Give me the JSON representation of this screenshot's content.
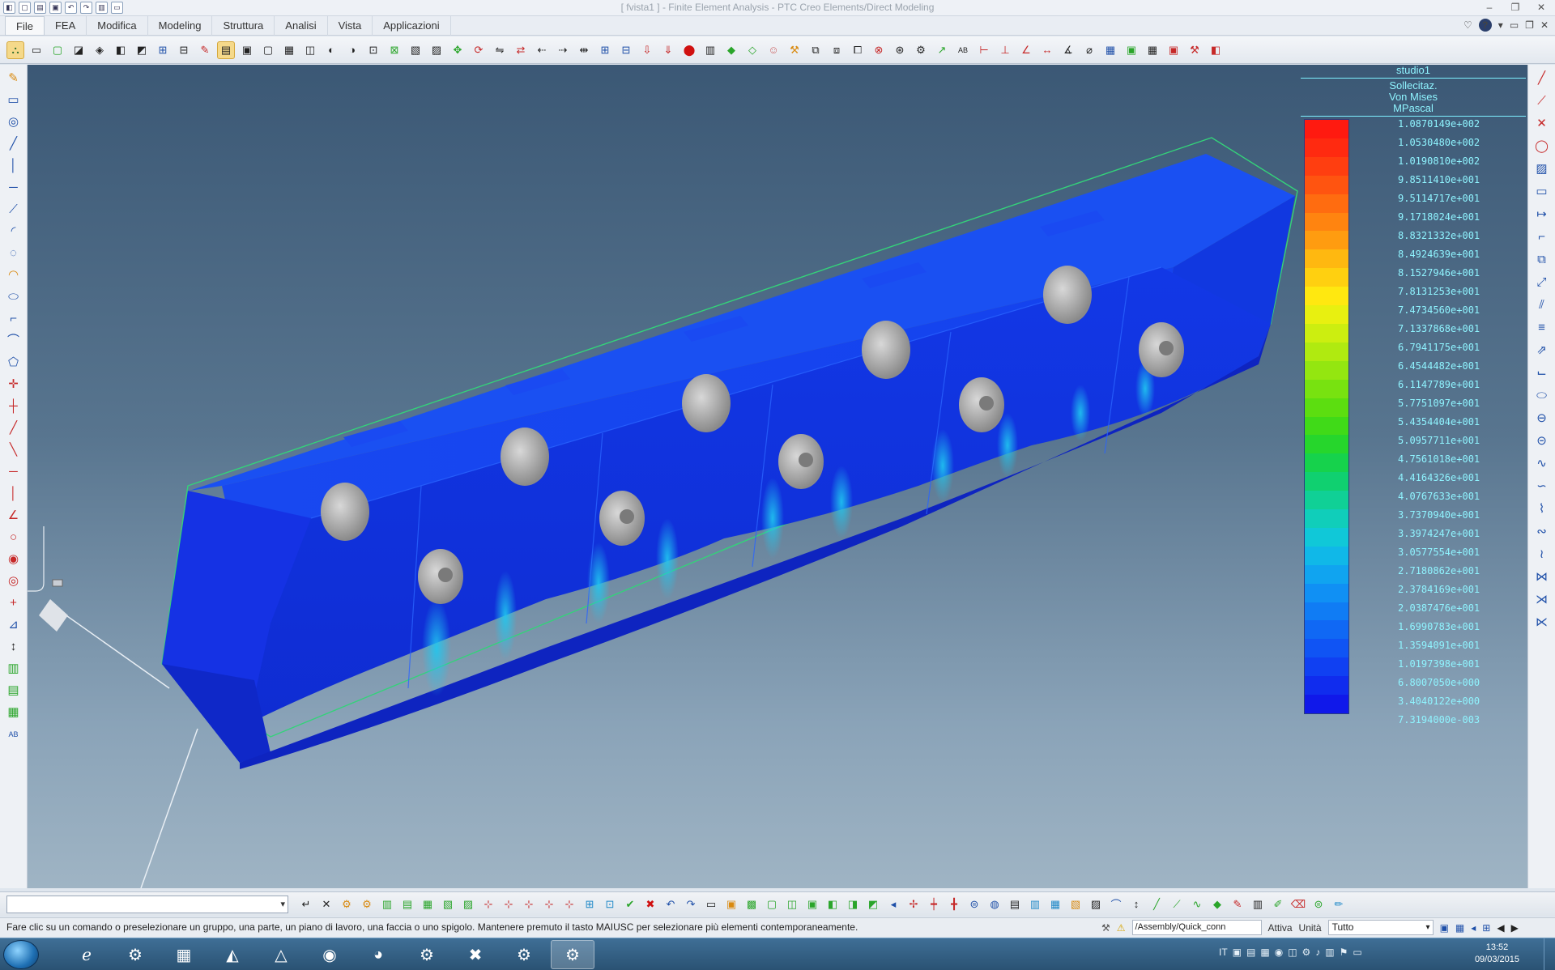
{
  "window": {
    "title": "[ fvista1 ] - Finite Element Analysis - PTC Creo Elements/Direct Modeling"
  },
  "menu": {
    "tabs": [
      "File",
      "FEA",
      "Modifica",
      "Modeling",
      "Struttura",
      "Analisi",
      "Vista",
      "Applicazioni"
    ]
  },
  "legend": {
    "study": "studio1",
    "quantity": "Sollecitaz.",
    "criterion": "Von Mises",
    "unit": "MPascal",
    "values": [
      "1.0870149e+002",
      "1.0530480e+002",
      "1.0190810e+002",
      "9.8511410e+001",
      "9.5114717e+001",
      "9.1718024e+001",
      "8.8321332e+001",
      "8.4924639e+001",
      "8.1527946e+001",
      "7.8131253e+001",
      "7.4734560e+001",
      "7.1337868e+001",
      "6.7941175e+001",
      "6.4544482e+001",
      "6.1147789e+001",
      "5.7751097e+001",
      "5.4354404e+001",
      "5.0957711e+001",
      "4.7561018e+001",
      "4.4164326e+001",
      "4.0767633e+001",
      "3.7370940e+001",
      "3.3974247e+001",
      "3.0577554e+001",
      "2.7180862e+001",
      "2.3784169e+001",
      "2.0387476e+001",
      "1.6990783e+001",
      "1.3594091e+001",
      "1.0197398e+001",
      "6.8007050e+000",
      "3.4040122e+000",
      "7.3194000e-003"
    ],
    "colors": [
      "#ff1a10",
      "#ff2a10",
      "#ff3e10",
      "#ff5410",
      "#ff6c10",
      "#ff8410",
      "#ff9c10",
      "#ffb810",
      "#ffd010",
      "#ffe810",
      "#e8f010",
      "#ccee10",
      "#b0ea10",
      "#94e610",
      "#78e210",
      "#5cde10",
      "#40da18",
      "#26d62c",
      "#16d24c",
      "#10d070",
      "#10d096",
      "#10ceba",
      "#10c8d8",
      "#10b8e8",
      "#10a4f0",
      "#1090f4",
      "#107cf4",
      "#1068f4",
      "#1054f4",
      "#1040f2",
      "#102cee",
      "#1018ea"
    ]
  },
  "status": {
    "message": "Fare clic su un comando o preselezionare un gruppo, una parte, un piano di lavoro, una faccia o uno spigolo. Mantenere premuto il tasto MAIUSC per selezionare più elementi contemporaneamente.",
    "path": "/Assembly/Quick_conn",
    "active_label": "Attiva",
    "units_label": "Unità",
    "filter": "Tutto"
  },
  "taskbar": {
    "lang": "IT",
    "time": "13:52",
    "date": "09/03/2015"
  }
}
